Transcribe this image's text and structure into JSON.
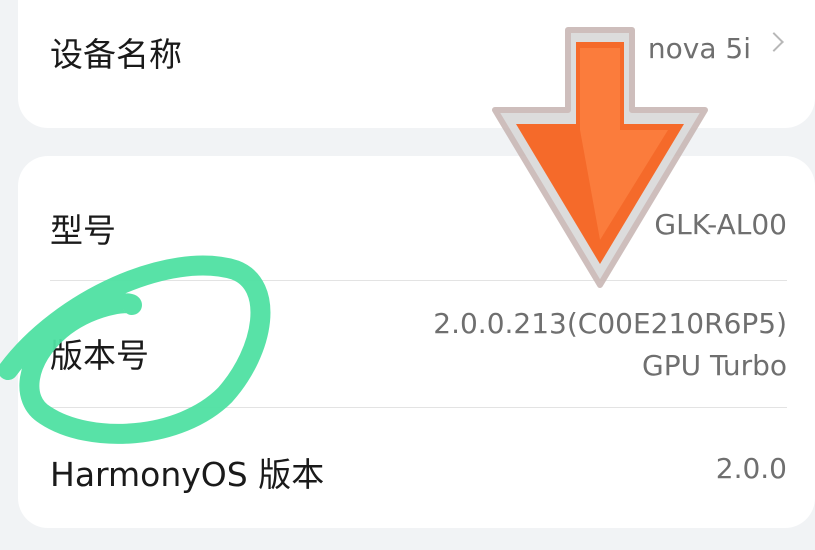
{
  "device_name": {
    "label": "设备名称",
    "value": "nova 5i"
  },
  "model": {
    "label": "型号",
    "value": "GLK-AL00"
  },
  "build_number": {
    "label": "版本号",
    "value_line1": "2.0.0.213(C00E210R6P5)",
    "value_line2": "GPU Turbo"
  },
  "harmonyos_version": {
    "label": "HarmonyOS 版本",
    "value": "2.0.0"
  },
  "icons": [
    "chevron-right-icon",
    "arrow-down-icon",
    "circle-annotation-icon"
  ],
  "colors": {
    "background": "#f1f3f5",
    "card": "#ffffff",
    "arrow": "#f56a2a",
    "circle_annotation": "#4fe0a2"
  }
}
